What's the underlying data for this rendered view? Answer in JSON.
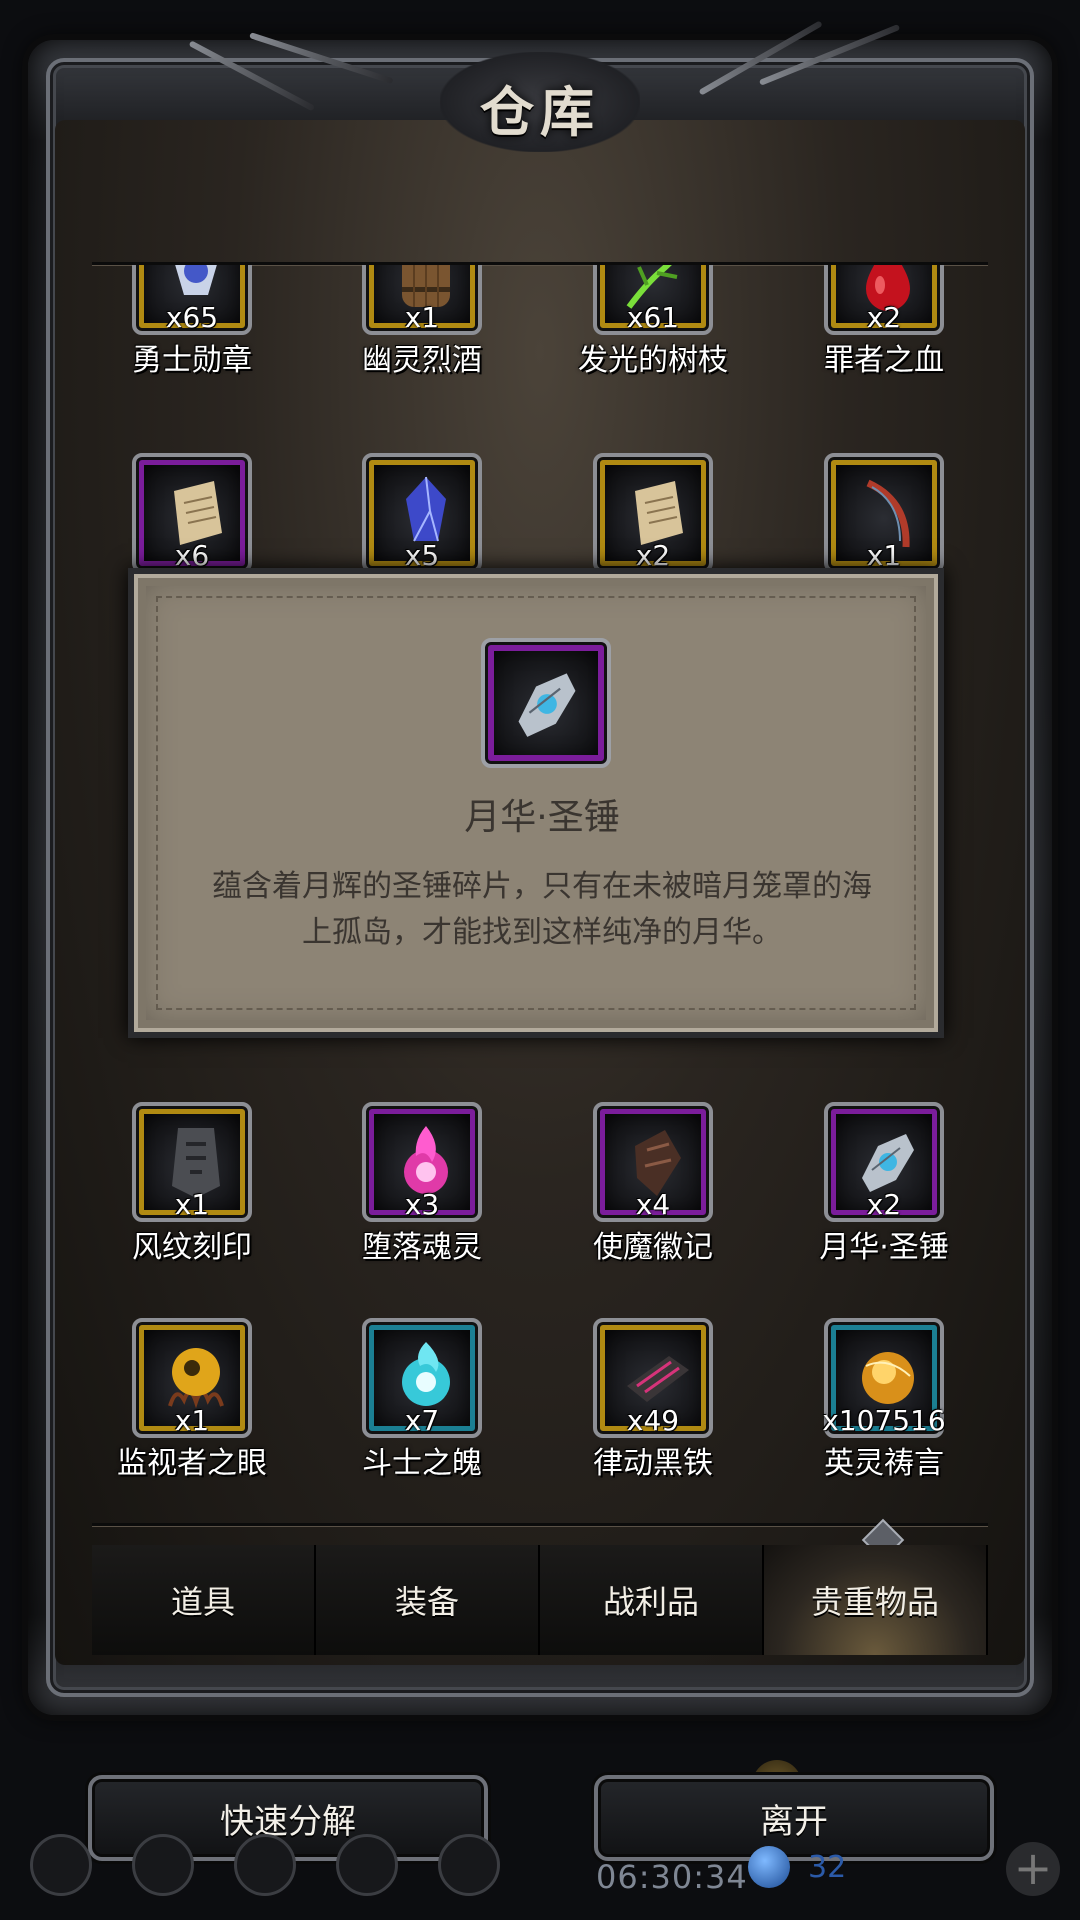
{
  "window": {
    "title": "仓库"
  },
  "items": [
    {
      "name": "勇士勋章",
      "qty": "x65",
      "rarity": "gold",
      "icon": "medal-icon"
    },
    {
      "name": "幽灵烈酒",
      "qty": "x1",
      "rarity": "gold",
      "icon": "barrel-icon"
    },
    {
      "name": "发光的树枝",
      "qty": "x61",
      "rarity": "gold",
      "icon": "glowing-branch-icon"
    },
    {
      "name": "罪者之血",
      "qty": "x2",
      "rarity": "gold",
      "icon": "blood-drop-icon"
    },
    {
      "name": "",
      "qty": "x6",
      "rarity": "purple",
      "icon": "scroll-icon"
    },
    {
      "name": "",
      "qty": "x5",
      "rarity": "gold",
      "icon": "crystal-icon"
    },
    {
      "name": "",
      "qty": "x2",
      "rarity": "gold",
      "icon": "scroll-icon"
    },
    {
      "name": "",
      "qty": "x1",
      "rarity": "gold",
      "icon": "feather-icon"
    },
    {
      "name": "风纹刻印",
      "qty": "x1",
      "rarity": "gold",
      "icon": "tablet-icon"
    },
    {
      "name": "堕落魂灵",
      "qty": "x3",
      "rarity": "purple",
      "icon": "soul-flame-icon"
    },
    {
      "name": "使魔徽记",
      "qty": "x4",
      "rarity": "purple",
      "icon": "emblem-icon"
    },
    {
      "name": "月华·圣锤",
      "qty": "x2",
      "rarity": "purple",
      "icon": "hammer-shard-icon"
    },
    {
      "name": "监视者之眼",
      "qty": "x1",
      "rarity": "gold",
      "icon": "eye-icon"
    },
    {
      "name": "斗士之魄",
      "qty": "x7",
      "rarity": "teal",
      "icon": "spirit-orb-icon"
    },
    {
      "name": "律动黑铁",
      "qty": "x49",
      "rarity": "gold",
      "icon": "iron-ingot-icon"
    },
    {
      "name": "英灵祷言",
      "qty": "x107516",
      "rarity": "teal",
      "icon": "golden-orb-icon"
    }
  ],
  "tooltip": {
    "name": "月华·圣锤",
    "description": "蕴含着月辉的圣锤碎片，只有在未被暗月笼罩的海上孤岛，才能找到这样纯净的月华。",
    "rarity": "purple",
    "icon": "hammer-shard-icon"
  },
  "tabs": [
    {
      "label": "道具",
      "active": false
    },
    {
      "label": "装备",
      "active": false
    },
    {
      "label": "战利品",
      "active": false
    },
    {
      "label": "贵重物品",
      "active": true
    }
  ],
  "buttons": {
    "decompose": "快速分解",
    "leave": "离开"
  },
  "hud": {
    "time": "06:30:34",
    "gems": "32"
  },
  "colors": {
    "gold": "#b08a12",
    "purple": "#7b1d9b",
    "teal": "#1b7f93",
    "parchment": "#8d8475"
  }
}
